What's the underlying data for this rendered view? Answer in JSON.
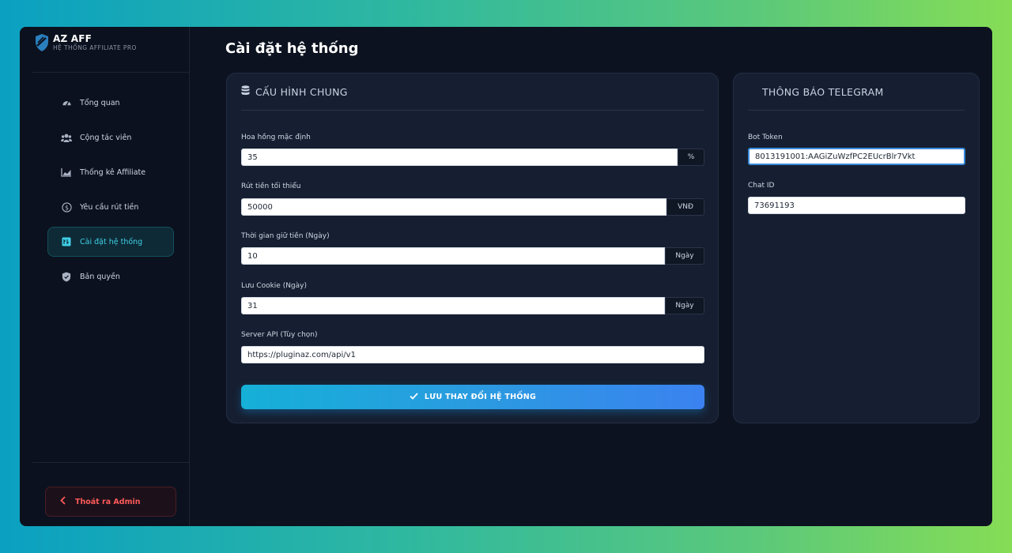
{
  "brand": {
    "name": "AZ AFF",
    "subtitle": "HỆ THỐNG AFFILIATE PRO"
  },
  "sidebar": {
    "items": [
      {
        "label": "Tổng quan",
        "icon": "gauge-icon"
      },
      {
        "label": "Cộng tác viên",
        "icon": "users-icon"
      },
      {
        "label": "Thống kê Affiliate",
        "icon": "chart-area-icon"
      },
      {
        "label": "Yêu cầu rút tiền",
        "icon": "dollar-circle-icon"
      },
      {
        "label": "Cài đặt hệ thống",
        "icon": "settings-icon",
        "active": true
      },
      {
        "label": "Bản quyền",
        "icon": "shield-icon"
      }
    ],
    "logout_label": "Thoát ra Admin"
  },
  "page": {
    "title": "Cài đặt hệ thống"
  },
  "general": {
    "heading": "CẤU HÌNH CHUNG",
    "commission": {
      "label": "Hoa hồng mặc định",
      "value": "35",
      "suffix": "%"
    },
    "min_withdraw": {
      "label": "Rút tiền tối thiểu",
      "value": "50000",
      "suffix": "VNĐ"
    },
    "hold_time": {
      "label": "Thời gian giữ tiền (Ngày)",
      "value": "10",
      "suffix": "Ngày"
    },
    "cookie": {
      "label": "Lưu Cookie (Ngày)",
      "value": "31",
      "suffix": "Ngày"
    },
    "server_api": {
      "label": "Server API (Tùy chọn)",
      "value": "https://pluginaz.com/api/v1"
    },
    "save_label": "LƯU THAY ĐỔI HỆ THỐNG"
  },
  "telegram": {
    "heading": "THÔNG BÁO TELEGRAM",
    "bot_token": {
      "label": "Bot Token",
      "value": "8013191001:AAGiZuWzfPC2EUcrBlr7Vkt"
    },
    "chat_id": {
      "label": "Chat ID",
      "value": "73691193"
    }
  },
  "colors": {
    "accent": "#3fd0e6",
    "danger": "#ff5a5a",
    "card": "#161f31",
    "bg": "#0c1220"
  }
}
